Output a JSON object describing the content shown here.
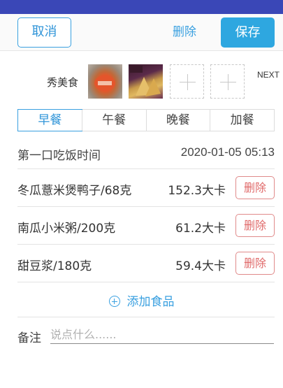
{
  "topbar": {
    "cancel_label": "取消",
    "delete_label": "删除",
    "save_label": "保存"
  },
  "photos": {
    "label": "秀美食",
    "next_label": "NEXT",
    "thumbnails": [
      "food-photo-1",
      "food-photo-2"
    ],
    "empty_slots": 2
  },
  "meal_tabs": {
    "items": [
      "早餐",
      "午餐",
      "晚餐",
      "加餐"
    ],
    "selected": "早餐"
  },
  "first_bite": {
    "label": "第一口吃饭时间",
    "value": "2020-01-05 05:13"
  },
  "foods": [
    {
      "name": "冬瓜薏米煲鸭子/68克",
      "calories": "152.3大卡",
      "delete_label": "删除"
    },
    {
      "name": "南瓜小米粥/200克",
      "calories": "61.2大卡",
      "delete_label": "删除"
    },
    {
      "name": "甜豆浆/180克",
      "calories": "59.4大卡",
      "delete_label": "删除"
    }
  ],
  "add_food_label": "添加食品",
  "note": {
    "label": "备注",
    "placeholder": "说点什么......",
    "value": ""
  },
  "colors": {
    "status_bar": "#3a47b7",
    "accent": "#2ea7e0",
    "delete_red": "#e06a6a"
  }
}
